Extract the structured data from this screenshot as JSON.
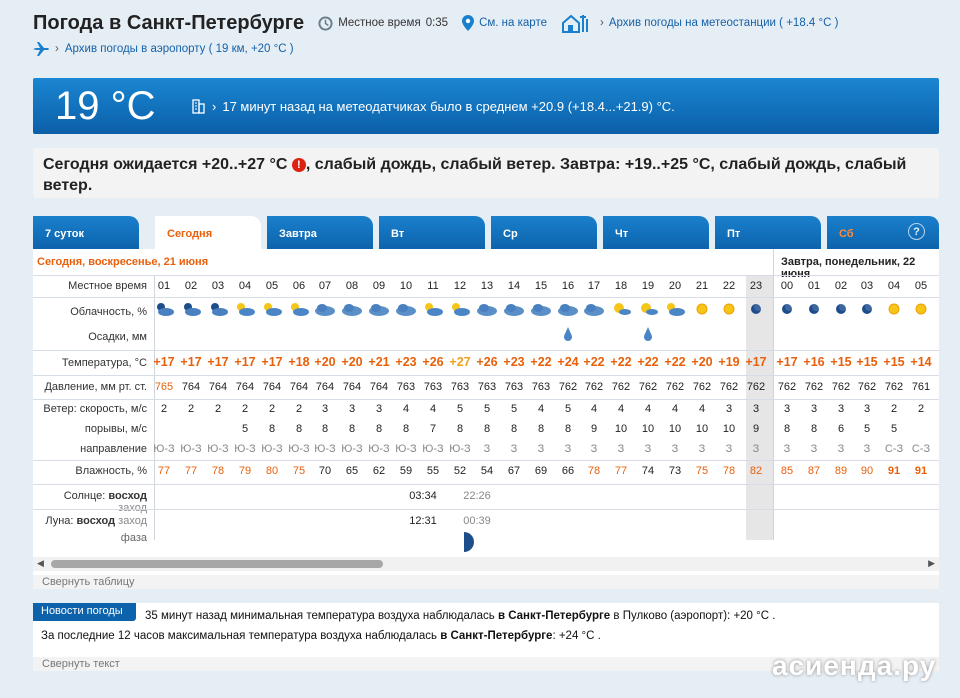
{
  "header": {
    "title": "Погода в Санкт-Петербурге",
    "local_time_label": "Местное время",
    "local_time": "0:35",
    "map_link": "См. на карте",
    "station_archive": "Архив погоды на метеостанции ( +18.4 °C )",
    "airport_archive": "Архив погоды в аэропорту ( 19 км, +20 °C )"
  },
  "now": {
    "temperature": "19 °C",
    "message": "17 минут назад на метеодатчиках было в среднем +20.9 (+18.4...+21.9) °C."
  },
  "forecast": {
    "today_part1": "Сегодня ожидается +20..+27 °C",
    "today_part2": ", слабый дождь, слабый ветер. Завтра: +19..+25 °C, слабый дождь, слабый ветер."
  },
  "tabs": [
    {
      "label": "7 суток"
    },
    {
      "label": "Сегодня",
      "active": true
    },
    {
      "label": "Завтра"
    },
    {
      "label": "Вт"
    },
    {
      "label": "Ср"
    },
    {
      "label": "Чт"
    },
    {
      "label": "Пт"
    },
    {
      "label": "Сб"
    }
  ],
  "help_label": "?",
  "table": {
    "day1": "Сегодня, воскресенье, 21 июня",
    "day2": "Завтра, понедельник, 22 июня",
    "labels": {
      "local_time": "Местное время",
      "cloud": "Облачность, %",
      "precip": "Осадки, мм",
      "temp": "Температура, °C",
      "pressure": "Давление, мм рт. ст.",
      "wind_speed": "Ветер: скорость, м/с",
      "gusts": "порывы, м/с",
      "direction": "направление",
      "humidity": "Влажность, %",
      "sun_a": "Солнце:",
      "sun_rise": "восход",
      "sun_set": "заход",
      "moon_a": "Луна:",
      "moon_rise": "восход",
      "moon_set": "заход",
      "moon_phase": "фаза"
    },
    "hours": [
      "01",
      "02",
      "03",
      "04",
      "05",
      "06",
      "07",
      "08",
      "09",
      "10",
      "11",
      "12",
      "13",
      "14",
      "15",
      "16",
      "17",
      "18",
      "19",
      "20",
      "21",
      "22",
      "23",
      "00",
      "01",
      "02",
      "03",
      "04",
      "05"
    ],
    "temps": [
      "+17",
      "+17",
      "+17",
      "+17",
      "+17",
      "+18",
      "+20",
      "+20",
      "+21",
      "+23",
      "+26",
      "+27",
      "+26",
      "+23",
      "+22",
      "+24",
      "+22",
      "+22",
      "+22",
      "+22",
      "+20",
      "+19",
      "+17",
      "+17",
      "+16",
      "+15",
      "+15",
      "+15",
      "+14"
    ],
    "pressure": [
      "765",
      "764",
      "764",
      "764",
      "764",
      "764",
      "764",
      "764",
      "764",
      "763",
      "763",
      "763",
      "763",
      "763",
      "763",
      "762",
      "762",
      "762",
      "762",
      "762",
      "762",
      "762",
      "762",
      "762",
      "762",
      "762",
      "762",
      "762",
      "761"
    ],
    "wind": [
      "2",
      "2",
      "2",
      "2",
      "2",
      "2",
      "3",
      "3",
      "3",
      "4",
      "4",
      "5",
      "5",
      "5",
      "4",
      "5",
      "4",
      "4",
      "4",
      "4",
      "4",
      "3",
      "3",
      "3",
      "3",
      "3",
      "3",
      "2",
      "2"
    ],
    "gusts": [
      "",
      "",
      "",
      "5",
      "8",
      "8",
      "8",
      "8",
      "8",
      "8",
      "7",
      "8",
      "8",
      "8",
      "8",
      "8",
      "9",
      "10",
      "10",
      "10",
      "10",
      "10",
      "9",
      "8",
      "8",
      "6",
      "5",
      "5",
      ""
    ],
    "dirs": [
      "Ю-З",
      "Ю-З",
      "Ю-З",
      "Ю-З",
      "Ю-З",
      "Ю-З",
      "Ю-З",
      "Ю-З",
      "Ю-З",
      "Ю-З",
      "Ю-З",
      "Ю-З",
      "З",
      "З",
      "З",
      "З",
      "З",
      "З",
      "З",
      "З",
      "З",
      "З",
      "З",
      "З",
      "З",
      "З",
      "З",
      "С-З",
      "С-З"
    ],
    "humidity": [
      "77",
      "77",
      "78",
      "79",
      "80",
      "75",
      "70",
      "65",
      "62",
      "59",
      "55",
      "52",
      "54",
      "67",
      "69",
      "66",
      "78",
      "77",
      "74",
      "73",
      "75",
      "78",
      "82",
      "85",
      "87",
      "89",
      "90",
      "91",
      "91"
    ],
    "sun_rise": "03:34",
    "sun_set": "22:26",
    "moon_rise": "12:31",
    "moon_set": "00:39"
  },
  "collapse_table": "Свернуть таблицу",
  "news": {
    "badge": "Новости погоды",
    "line1_a": "35 минут назад минимальная температура воздуха наблюдалась ",
    "line1_b": "в Санкт-Петербурге",
    "line1_c": " в Пулково (аэропорт): +20 °С .",
    "line2_a": "За последние 12 часов максимальная температура воздуха наблюдалась ",
    "line2_b": "в Санкт-Петербурге",
    "line2_c": ": +24 °С .",
    "collapse": "Свернуть текст"
  },
  "watermark": "асиенда.ру",
  "colors": {
    "accent": "#0d63ab",
    "warm": "#e8600c",
    "link": "#1560a8"
  }
}
